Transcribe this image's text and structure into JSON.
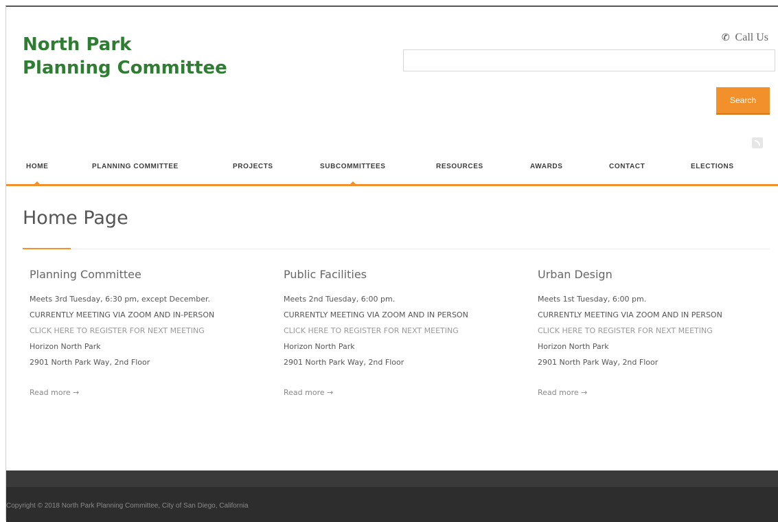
{
  "header": {
    "site_title_line1": "North Park",
    "site_title_line2": "Planning Committee",
    "call_us_label": "Call Us",
    "search_value": "",
    "search_button_label": "Search"
  },
  "nav": {
    "items": [
      {
        "label": "HOME"
      },
      {
        "label": "PLANNING COMMITTEE"
      },
      {
        "label": "PROJECTS"
      },
      {
        "label": "SUBCOMMITTEES"
      },
      {
        "label": "RESOURCES"
      },
      {
        "label": "AWARDS"
      },
      {
        "label": "CONTACT"
      },
      {
        "label": "ELECTIONS"
      }
    ]
  },
  "main": {
    "page_title": "Home Page",
    "columns": [
      {
        "heading": "Planning Committee",
        "meets": "Meets 3rd Tuesday, 6:30 pm, except December.",
        "status": "CURRENTLY MEETING VIA ZOOM AND IN-PERSON",
        "register_link": "CLICK HERE TO REGISTER FOR NEXT MEETING",
        "venue": "Horizon North Park",
        "address": "2901 North Park Way, 2nd Floor",
        "read_more": "Read more →"
      },
      {
        "heading": "Public Facilities",
        "meets": "Meets 2nd Tuesday, 6:00 pm.",
        "status": "CURRENTLY MEETING VIA ZOOM AND IN PERSON",
        "register_link": "CLICK HERE TO REGISTER FOR NEXT MEETING",
        "venue": "Horizon North Park",
        "address": "2901 North Park Way, 2nd Floor",
        "read_more": "Read more →"
      },
      {
        "heading": "Urban Design",
        "meets": "Meets 1st Tuesday, 6:00 pm.",
        "status": "CURRENTLY MEETING VIA ZOOM AND IN PERSON",
        "register_link": "CLICK HERE TO REGISTER FOR NEXT MEETING",
        "venue": "Horizon North Park",
        "address": "2901 North Park Way, 2nd Floor",
        "read_more": "Read more →"
      }
    ]
  },
  "footer": {
    "copyright": "Copyright © 2018 North Park Planning Committee, City of San Diego, California"
  },
  "icons": {
    "phone": "phone-icon",
    "rss": "rss-icon"
  },
  "colors": {
    "brand_green": "#2e7d32",
    "accent_orange": "#f2912c",
    "footer_dark": "#2d2d2d"
  }
}
